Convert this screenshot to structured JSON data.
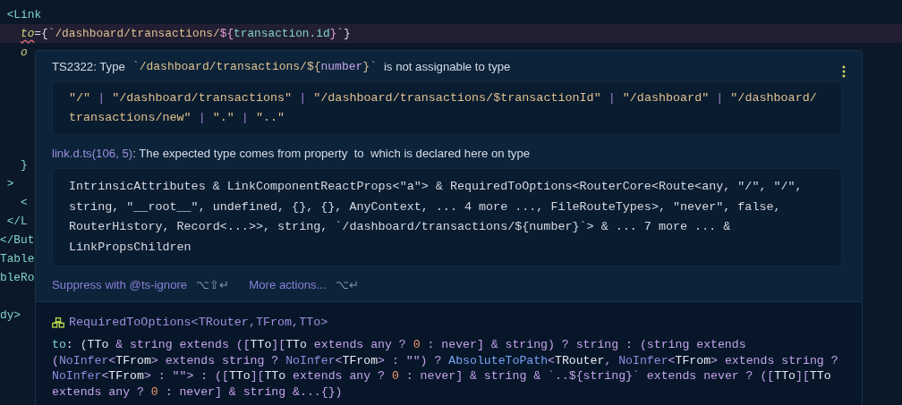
{
  "editor": {
    "lines": [
      {
        "text": " <Link",
        "highlighted": false
      },
      {
        "tokens": [
          {
            "kind": "attr",
            "text": "to",
            "error": true
          },
          {
            "kind": "plain",
            "text": "={`"
          },
          {
            "kind": "str",
            "text": "/dashboard/transactions/"
          },
          {
            "kind": "op",
            "text": "${"
          },
          {
            "kind": "prop",
            "text": "transaction.id"
          },
          {
            "kind": "op",
            "text": "}"
          },
          {
            "kind": "plain",
            "text": "`}"
          }
        ],
        "highlighted": true
      },
      {
        "text": "   o",
        "highlighted": false
      },
      {
        "text": "   }",
        "highlighted": false
      },
      {
        "text": " >",
        "highlighted": false
      },
      {
        "text": "   <",
        "highlighted": false
      },
      {
        "text": " </L",
        "highlighted": false
      },
      {
        "text": "</But",
        "highlighted": false
      },
      {
        "text": "Table",
        "highlighted": false
      },
      {
        "text": "bleRo",
        "highlighted": false
      },
      {
        "text": "dy>",
        "highlighted": false
      }
    ]
  },
  "hover": {
    "error_header": [
      {
        "kind": "label",
        "text": "TS2322: Type"
      },
      {
        "kind": "code",
        "tokens": [
          {
            "kind": "str",
            "text": "`/dashboard/transactions/${"
          },
          {
            "kind": "kw",
            "text": "number"
          },
          {
            "kind": "str",
            "text": "}`"
          }
        ]
      },
      {
        "kind": "label",
        "text": "is not assignable to type"
      }
    ],
    "expected_block": [
      [
        {
          "kind": "str",
          "text": "\"/\""
        },
        {
          "kind": "op",
          "text": " | "
        },
        {
          "kind": "str",
          "text": "\"/dashboard/transactions\""
        },
        {
          "kind": "op",
          "text": " | "
        },
        {
          "kind": "str",
          "text": "\"/dashboard/transactions/$transactionId\""
        },
        {
          "kind": "op",
          "text": " | "
        },
        {
          "kind": "str",
          "text": "\"/dashboard\""
        },
        {
          "kind": "op",
          "text": " | "
        },
        {
          "kind": "str",
          "text": "\"/dashboard/"
        }
      ],
      [
        {
          "kind": "str",
          "text": "transactions/new\""
        },
        {
          "kind": "op",
          "text": " | "
        },
        {
          "kind": "str",
          "text": "\".\""
        },
        {
          "kind": "op",
          "text": " | "
        },
        {
          "kind": "str",
          "text": "\"..\""
        }
      ]
    ],
    "related": {
      "link": "link.d.ts(106, 5)",
      "before": ": The expected type comes from property",
      "property": "to",
      "after": "which is declared here on type"
    },
    "declared_block": [
      "IntrinsicAttributes & LinkComponentReactProps<\"a\"> & RequiredToOptions<RouterCore<Route<any, \"/\", \"/\",",
      "string, \"__root__\", undefined, {}, {}, AnyContext, ... 4 more ..., FileRouteTypes>, \"never\", false,",
      "RouterHistory, Record<...>>, string, `/dashboard/transactions/${number}`> & ... 7 more ... &",
      "LinkPropsChildren"
    ],
    "actions": [
      {
        "label": "Suppress with @ts-ignore",
        "shortcut": "⌥⇧↵"
      },
      {
        "label": "More actions...",
        "shortcut": "⌥↵"
      }
    ],
    "symbol": "RequiredToOptions<TRouter,TFrom,TTo>",
    "signature": [
      [
        {
          "kind": "prop",
          "text": "to"
        },
        {
          "kind": "plain",
          "text": ": ("
        },
        {
          "kind": "type",
          "text": "TTo"
        },
        {
          "kind": "kw",
          "text": " & string extends (["
        },
        {
          "kind": "type",
          "text": "TTo"
        },
        {
          "kind": "kw",
          "text": "]["
        },
        {
          "kind": "type",
          "text": "TTo"
        },
        {
          "kind": "kw",
          "text": " extends any ? "
        },
        {
          "kind": "num",
          "text": "0"
        },
        {
          "kind": "kw",
          "text": " : never] & string) ? string : (string extends"
        }
      ],
      [
        {
          "kind": "kw",
          "text": "("
        },
        {
          "kind": "gen",
          "text": "NoInfer"
        },
        {
          "kind": "kw",
          "text": "<"
        },
        {
          "kind": "type",
          "text": "TFrom"
        },
        {
          "kind": "kw",
          "text": "> extends string ? "
        },
        {
          "kind": "gen",
          "text": "NoInfer"
        },
        {
          "kind": "kw",
          "text": "<"
        },
        {
          "kind": "type",
          "text": "TFrom"
        },
        {
          "kind": "kw",
          "text": "> : \"\") ? "
        },
        {
          "kind": "fn",
          "text": "AbsoluteToPath"
        },
        {
          "kind": "kw",
          "text": "<"
        },
        {
          "kind": "type",
          "text": "TRouter"
        },
        {
          "kind": "kw",
          "text": ", "
        },
        {
          "kind": "gen",
          "text": "NoInfer"
        },
        {
          "kind": "kw",
          "text": "<"
        },
        {
          "kind": "type",
          "text": "TFrom"
        },
        {
          "kind": "kw",
          "text": "> extends string ?"
        }
      ],
      [
        {
          "kind": "gen",
          "text": "NoInfer"
        },
        {
          "kind": "kw",
          "text": "<"
        },
        {
          "kind": "type",
          "text": "TFrom"
        },
        {
          "kind": "kw",
          "text": "> : \"\"> : (["
        },
        {
          "kind": "type",
          "text": "TTo"
        },
        {
          "kind": "kw",
          "text": "]["
        },
        {
          "kind": "type",
          "text": "TTo"
        },
        {
          "kind": "kw",
          "text": " extends any ? "
        },
        {
          "kind": "num",
          "text": "0"
        },
        {
          "kind": "kw",
          "text": " : never] & string & `..${string}` extends never ? (["
        },
        {
          "kind": "type",
          "text": "TTo"
        },
        {
          "kind": "kw",
          "text": "]["
        },
        {
          "kind": "type",
          "text": "TTo"
        }
      ],
      [
        {
          "kind": "kw",
          "text": "extends any ? "
        },
        {
          "kind": "num",
          "text": "0"
        },
        {
          "kind": "kw",
          "text": " : never] & string &...{})"
        }
      ]
    ]
  }
}
